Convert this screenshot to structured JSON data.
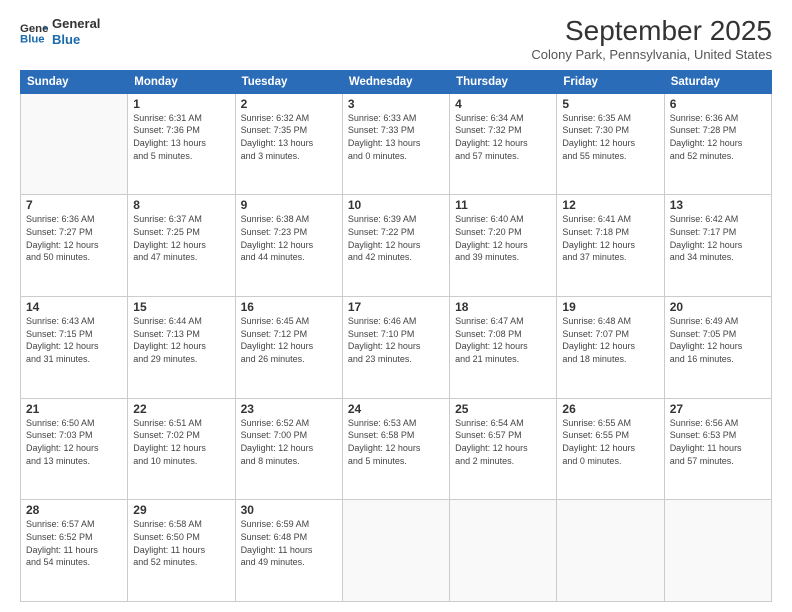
{
  "header": {
    "logo_line1": "General",
    "logo_line2": "Blue",
    "month": "September 2025",
    "location": "Colony Park, Pennsylvania, United States"
  },
  "weekdays": [
    "Sunday",
    "Monday",
    "Tuesday",
    "Wednesday",
    "Thursday",
    "Friday",
    "Saturday"
  ],
  "weeks": [
    [
      {
        "day": "",
        "info": ""
      },
      {
        "day": "1",
        "info": "Sunrise: 6:31 AM\nSunset: 7:36 PM\nDaylight: 13 hours\nand 5 minutes."
      },
      {
        "day": "2",
        "info": "Sunrise: 6:32 AM\nSunset: 7:35 PM\nDaylight: 13 hours\nand 3 minutes."
      },
      {
        "day": "3",
        "info": "Sunrise: 6:33 AM\nSunset: 7:33 PM\nDaylight: 13 hours\nand 0 minutes."
      },
      {
        "day": "4",
        "info": "Sunrise: 6:34 AM\nSunset: 7:32 PM\nDaylight: 12 hours\nand 57 minutes."
      },
      {
        "day": "5",
        "info": "Sunrise: 6:35 AM\nSunset: 7:30 PM\nDaylight: 12 hours\nand 55 minutes."
      },
      {
        "day": "6",
        "info": "Sunrise: 6:36 AM\nSunset: 7:28 PM\nDaylight: 12 hours\nand 52 minutes."
      }
    ],
    [
      {
        "day": "7",
        "info": "Sunrise: 6:36 AM\nSunset: 7:27 PM\nDaylight: 12 hours\nand 50 minutes."
      },
      {
        "day": "8",
        "info": "Sunrise: 6:37 AM\nSunset: 7:25 PM\nDaylight: 12 hours\nand 47 minutes."
      },
      {
        "day": "9",
        "info": "Sunrise: 6:38 AM\nSunset: 7:23 PM\nDaylight: 12 hours\nand 44 minutes."
      },
      {
        "day": "10",
        "info": "Sunrise: 6:39 AM\nSunset: 7:22 PM\nDaylight: 12 hours\nand 42 minutes."
      },
      {
        "day": "11",
        "info": "Sunrise: 6:40 AM\nSunset: 7:20 PM\nDaylight: 12 hours\nand 39 minutes."
      },
      {
        "day": "12",
        "info": "Sunrise: 6:41 AM\nSunset: 7:18 PM\nDaylight: 12 hours\nand 37 minutes."
      },
      {
        "day": "13",
        "info": "Sunrise: 6:42 AM\nSunset: 7:17 PM\nDaylight: 12 hours\nand 34 minutes."
      }
    ],
    [
      {
        "day": "14",
        "info": "Sunrise: 6:43 AM\nSunset: 7:15 PM\nDaylight: 12 hours\nand 31 minutes."
      },
      {
        "day": "15",
        "info": "Sunrise: 6:44 AM\nSunset: 7:13 PM\nDaylight: 12 hours\nand 29 minutes."
      },
      {
        "day": "16",
        "info": "Sunrise: 6:45 AM\nSunset: 7:12 PM\nDaylight: 12 hours\nand 26 minutes."
      },
      {
        "day": "17",
        "info": "Sunrise: 6:46 AM\nSunset: 7:10 PM\nDaylight: 12 hours\nand 23 minutes."
      },
      {
        "day": "18",
        "info": "Sunrise: 6:47 AM\nSunset: 7:08 PM\nDaylight: 12 hours\nand 21 minutes."
      },
      {
        "day": "19",
        "info": "Sunrise: 6:48 AM\nSunset: 7:07 PM\nDaylight: 12 hours\nand 18 minutes."
      },
      {
        "day": "20",
        "info": "Sunrise: 6:49 AM\nSunset: 7:05 PM\nDaylight: 12 hours\nand 16 minutes."
      }
    ],
    [
      {
        "day": "21",
        "info": "Sunrise: 6:50 AM\nSunset: 7:03 PM\nDaylight: 12 hours\nand 13 minutes."
      },
      {
        "day": "22",
        "info": "Sunrise: 6:51 AM\nSunset: 7:02 PM\nDaylight: 12 hours\nand 10 minutes."
      },
      {
        "day": "23",
        "info": "Sunrise: 6:52 AM\nSunset: 7:00 PM\nDaylight: 12 hours\nand 8 minutes."
      },
      {
        "day": "24",
        "info": "Sunrise: 6:53 AM\nSunset: 6:58 PM\nDaylight: 12 hours\nand 5 minutes."
      },
      {
        "day": "25",
        "info": "Sunrise: 6:54 AM\nSunset: 6:57 PM\nDaylight: 12 hours\nand 2 minutes."
      },
      {
        "day": "26",
        "info": "Sunrise: 6:55 AM\nSunset: 6:55 PM\nDaylight: 12 hours\nand 0 minutes."
      },
      {
        "day": "27",
        "info": "Sunrise: 6:56 AM\nSunset: 6:53 PM\nDaylight: 11 hours\nand 57 minutes."
      }
    ],
    [
      {
        "day": "28",
        "info": "Sunrise: 6:57 AM\nSunset: 6:52 PM\nDaylight: 11 hours\nand 54 minutes."
      },
      {
        "day": "29",
        "info": "Sunrise: 6:58 AM\nSunset: 6:50 PM\nDaylight: 11 hours\nand 52 minutes."
      },
      {
        "day": "30",
        "info": "Sunrise: 6:59 AM\nSunset: 6:48 PM\nDaylight: 11 hours\nand 49 minutes."
      },
      {
        "day": "",
        "info": ""
      },
      {
        "day": "",
        "info": ""
      },
      {
        "day": "",
        "info": ""
      },
      {
        "day": "",
        "info": ""
      }
    ]
  ]
}
